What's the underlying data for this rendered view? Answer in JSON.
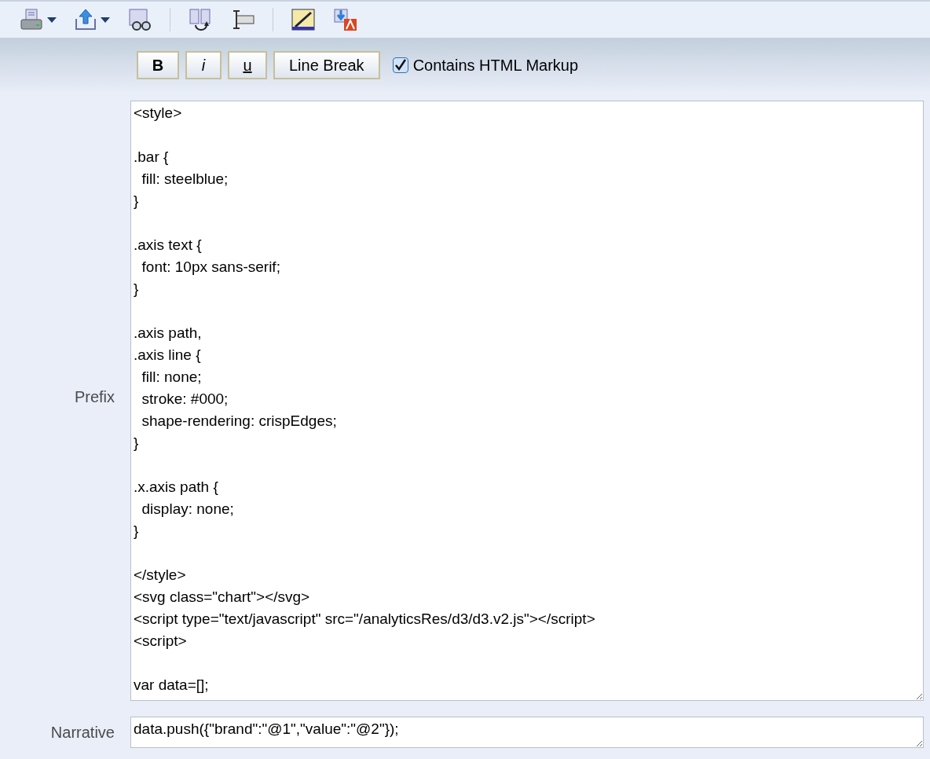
{
  "toolbar": {
    "buttons": [
      {
        "kind": "print",
        "dropdown": true
      },
      {
        "kind": "export",
        "dropdown": true
      },
      {
        "kind": "preview",
        "dropdown": false
      },
      {
        "kind": "separator"
      },
      {
        "kind": "swap",
        "dropdown": false
      },
      {
        "kind": "field",
        "dropdown": false
      },
      {
        "kind": "separator"
      },
      {
        "kind": "chart",
        "dropdown": false
      },
      {
        "kind": "import",
        "dropdown": false
      }
    ]
  },
  "format_bar": {
    "buttons": [
      {
        "kind": "bold",
        "label": "B"
      },
      {
        "kind": "italic",
        "label": "i"
      },
      {
        "kind": "underline",
        "label": "u"
      },
      {
        "kind": "plain",
        "label": "Line Break"
      }
    ],
    "html_checkbox": {
      "label": "Contains HTML Markup",
      "checked": true
    }
  },
  "fields": [
    {
      "label": "Prefix",
      "kind": "large",
      "value": "<style>\n\n.bar {\n  fill: steelblue;\n}\n\n.axis text {\n  font: 10px sans-serif;\n}\n\n.axis path,\n.axis line {\n  fill: none;\n  stroke: #000;\n  shape-rendering: crispEdges;\n}\n\n.x.axis path {\n  display: none;\n}\n\n</style>\n<svg class=\"chart\"></svg>\n<script type=\"text/javascript\" src=\"/analyticsRes/d3/d3.v2.js\"></script>\n<script>\n\nvar data=[];"
    },
    {
      "label": "Narrative",
      "kind": "small",
      "value": "data.push({\"brand\":\"@1\",\"value\":\"@2\"});"
    }
  ]
}
